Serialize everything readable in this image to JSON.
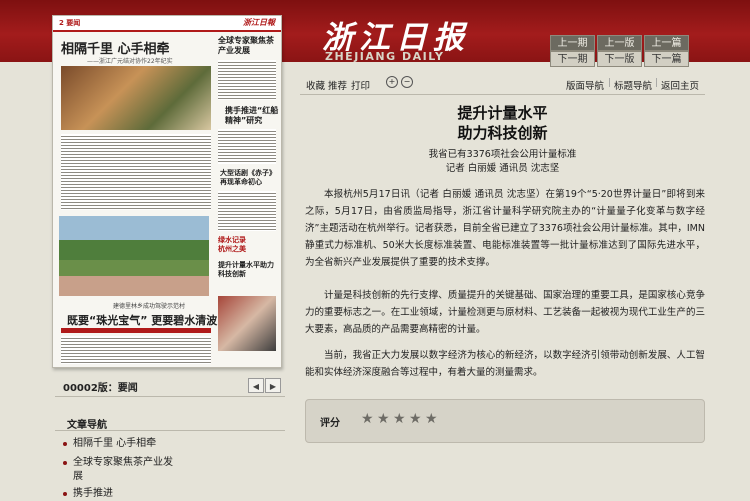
{
  "header": {
    "logo_cn": "浙江日报",
    "logo_en": "ZHEJIANG DAILY",
    "nav": {
      "prev_issue": "上一期",
      "prev_page": "上一版",
      "prev_article": "上一篇",
      "next_issue": "下一期",
      "next_page": "下一版",
      "next_article": "下一篇"
    }
  },
  "thumbnail": {
    "page_num": "2 要闻",
    "logo": "浙江日報",
    "headline1": "相隔千里 心手相牵",
    "subline": "——浙江广元结对协作22年纪实",
    "right1": "全球专家聚焦茶产业发展",
    "right2": "携手推进“红船精神”研究",
    "right3": "大型话剧《赤子》再现革命初心",
    "right4": "绿水记录杭州之美",
    "right5": "提升计量水平助力科技创新",
    "caption": "建德里林乡成功驾驶示范村",
    "headline2": "既要“珠光宝气” 更要碧水清波"
  },
  "page_bar": {
    "label": "00002版：要闻",
    "prev_arrow": "◀",
    "next_arrow": "▶"
  },
  "article_nav": {
    "title": "文章导航",
    "items": [
      "相隔千里 心手相牵",
      "全球专家聚焦茶产业发展",
      "携手推进"
    ]
  },
  "toolbar": {
    "collect": "收藏",
    "recommend": "推荐",
    "print": "打印",
    "zoom_in": "+",
    "zoom_out": "−",
    "page_nav": "版面导航",
    "title_nav": "标题导航",
    "home": "返回主页"
  },
  "article": {
    "title_line1": "提升计量水平",
    "title_line2": "助力科技创新",
    "subtitle": "我省已有3376项社会公用计量标准",
    "byline": "记者 白丽媛 通讯员 沈志坚",
    "p1": "本报杭州5月17日讯（记者 白丽媛 通讯员 沈志坚）在第19个“5·20世界计量日”即将到来之际，5月17日，由省质监局指导，浙江省计量科学研究院主办的“计量量子化变革与数字经济”主题活动在杭州举行。记者获悉，目前全省已建立了3376项社会公用计量标准。其中，IMN静重式力标准机、50米大长度标准装置、电能标准装置等一批计量标准达到了国际先进水平，为全省新兴产业发展提供了重要的技术支撑。",
    "p2": "计量是科技创新的先行支撑、质量提升的关键基础、国家治理的重要工具，是国家核心竞争力的重要标志之一。在工业领域，计量检测更与原材料、工艺装备一起被视为现代工业生产的三大要素，高品质的产品需要高精密的计量。",
    "p3": "当前，我省正大力发展以数字经济为核心的新经济，以数字经济引领带动创新发展、人工智能和实体经济深度融合等过程中，有着大量的测量需求。"
  },
  "rating": {
    "label": "评分",
    "stars": "★",
    "count": 5
  },
  "colors": {
    "brand_red": "#a31c1c",
    "background": "#e5e3d8"
  }
}
